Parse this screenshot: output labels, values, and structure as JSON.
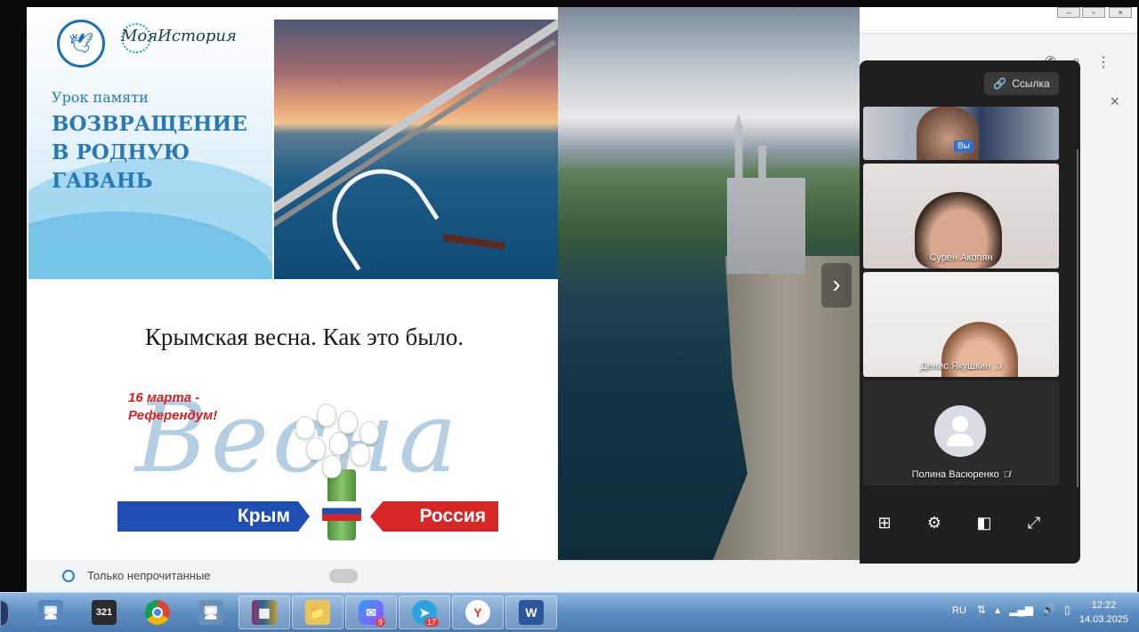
{
  "slide": {
    "subtitle": "Урок памяти",
    "title_line1": "ВОЗВРАЩЕНИЕ",
    "title_line2": "В РОДНУЮ",
    "title_line3": "ГАВАНЬ",
    "caption": "Крымская весна. Как это было.",
    "date_line1": "16 марта -",
    "date_line2": "Референдум!",
    "vesna_word": "Весна",
    "banner_left": "Крым",
    "banner_right": "Россия"
  },
  "call": {
    "link_button": "Ссылка",
    "participants": [
      {
        "name": "",
        "badge": "Вы"
      },
      {
        "name": "Сурен Акопян"
      },
      {
        "name": "Денис Якушкин",
        "muted": true
      },
      {
        "name": "Полина Васюренко",
        "muted": true
      }
    ],
    "controls": [
      "grid-icon",
      "settings-icon",
      "pip-icon",
      "fullscreen-icon"
    ]
  },
  "background_app": {
    "filter_label": "Только непрочитанные"
  },
  "taskbar": {
    "apps": [
      {
        "name": "computer",
        "glyph": "🖥"
      },
      {
        "name": "media-player-classic",
        "glyph": "321"
      },
      {
        "name": "chrome",
        "glyph": "◉"
      },
      {
        "name": "remote-desktop",
        "glyph": "🖥"
      },
      {
        "name": "winrar",
        "glyph": "▦"
      },
      {
        "name": "file-explorer",
        "glyph": "📁"
      },
      {
        "name": "messenger",
        "glyph": "✉",
        "badge": "9"
      },
      {
        "name": "telegram",
        "glyph": "➤",
        "badge": "17"
      },
      {
        "name": "yandex-browser",
        "glyph": "Y"
      },
      {
        "name": "word",
        "glyph": "W"
      }
    ],
    "language": "RU",
    "time": "12:22",
    "date": "14.03.2025"
  },
  "colors": {
    "slide_title": "#2a78b6",
    "banner_blue": "#1f4fb3",
    "banner_red": "#d62626",
    "panel_bg": "#1f1f1f"
  }
}
